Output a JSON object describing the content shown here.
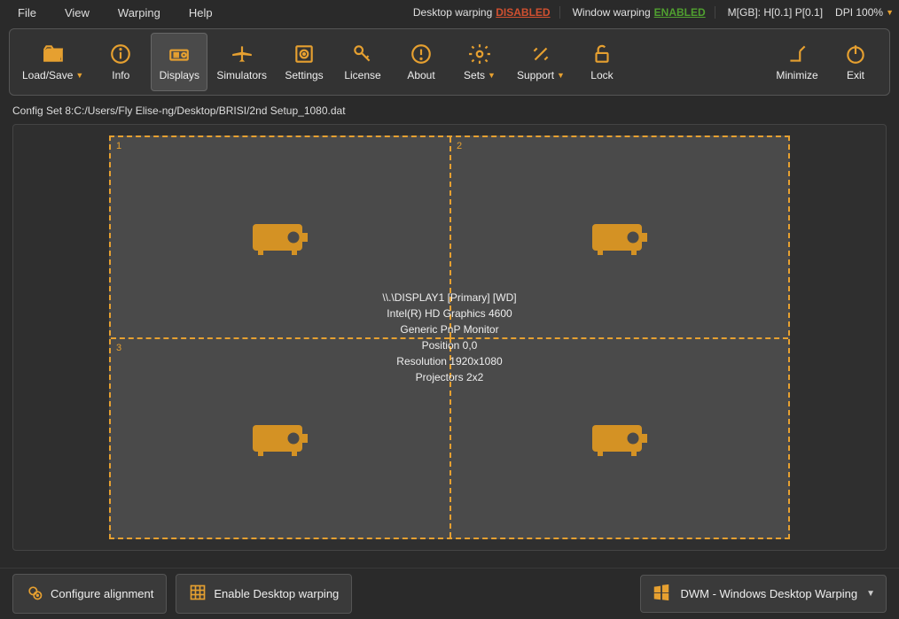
{
  "menu": {
    "file": "File",
    "view": "View",
    "warping": "Warping",
    "help": "Help"
  },
  "status": {
    "desktop_label": "Desktop warping",
    "desktop_value": "DISABLED",
    "window_label": "Window warping",
    "window_value": "ENABLED",
    "gb": "M[GB]: H[0.1] P[0.1]",
    "dpi": "DPI 100%"
  },
  "toolbar": {
    "loadsave": "Load/Save",
    "info": "Info",
    "displays": "Displays",
    "simulators": "Simulators",
    "settings": "Settings",
    "license": "License",
    "about": "About",
    "sets": "Sets",
    "support": "Support",
    "lock": "Lock",
    "minimize": "Minimize",
    "exit": "Exit"
  },
  "config_path": "Config Set 8:C:/Users/Fly Elise-ng/Desktop/BRISI/2nd Setup_1080.dat",
  "display": {
    "cell1": "1",
    "cell2": "2",
    "cell3": "3",
    "line1": "\\\\.\\DISPLAY1 [Primary] [WD]",
    "line2": "Intel(R) HD Graphics 4600",
    "line3": "Generic PnP Monitor",
    "line4": "Position 0,0",
    "line5": "Resolution 1920x1080",
    "line6": "Projectors 2x2"
  },
  "footer": {
    "configure": "Configure alignment",
    "enable": "Enable Desktop warping",
    "dwm": "DWM - Windows Desktop Warping"
  }
}
